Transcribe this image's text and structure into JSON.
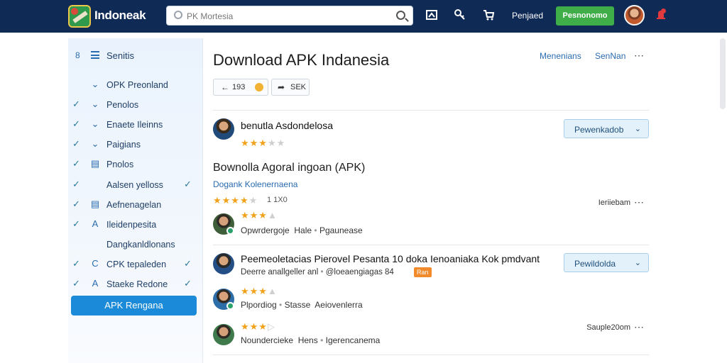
{
  "header": {
    "brand": "Indoneak",
    "search_placeholder": "PK Mortesia",
    "link": "Penjaed",
    "cta": "Pesnonomo"
  },
  "sidebar": {
    "heading_num": "8",
    "heading": "Senitis",
    "items": [
      {
        "label": "OPK Preonland",
        "icon": "chevron-down",
        "left_check": false,
        "right_check": false
      },
      {
        "label": "Penolos",
        "icon": "chevron-down",
        "left_check": true,
        "right_check": false
      },
      {
        "label": "Enaete Ileinns",
        "icon": "chevron-down",
        "left_check": true,
        "right_check": false
      },
      {
        "label": "Paigians",
        "icon": "chevron-down",
        "left_check": true,
        "right_check": false
      },
      {
        "label": "Pnolos",
        "icon": "doc",
        "left_check": true,
        "right_check": false
      },
      {
        "label": "Aalsen yelloss",
        "icon": "",
        "left_check": true,
        "right_check": true
      },
      {
        "label": "Aefnenagelan",
        "icon": "doc",
        "left_check": true,
        "right_check": false
      },
      {
        "label": "Ileidenpesita",
        "icon": "letter",
        "left_check": true,
        "right_check": false
      },
      {
        "label": "Dangkanldlonans",
        "icon": "",
        "left_check": false,
        "right_check": false
      },
      {
        "label": "CPK tepaleden",
        "icon": "circle",
        "left_check": true,
        "right_check": true
      },
      {
        "label": "Staeke Redone",
        "icon": "letter",
        "left_check": true,
        "right_check": true
      }
    ],
    "active": "APK Rengana"
  },
  "main": {
    "title": "Download APK Indanesia",
    "links": [
      "Menenians",
      "SenNan"
    ],
    "pill_count": "193",
    "pill_share": "SEK",
    "apps": [
      {
        "name": "benutla Asdondelosa",
        "rating": 2.5,
        "download_label": "Pewenkadob"
      },
      {
        "name": "Peemeoletacias Pierovel Pesanta 10 doka Ienoaniaka Kok pmdvant",
        "meta1": "Deerre anallgeller anl",
        "meta2": "@loeaengiagas 84",
        "tag": "Ran",
        "download_label": "Pewildolda"
      }
    ],
    "section": {
      "title": "Bownolla Agoral ingoan (APK)",
      "subtitle": "Dogank Kolenernaena",
      "rating_value": "1 1X0"
    },
    "reviews": [
      {
        "stars": 3,
        "author": "Opwrdergoje",
        "place": "Hale",
        "text": "Pgaunease",
        "time": "Ieriiebam"
      },
      {
        "stars": 3,
        "author": "Plpordiog",
        "place": "Stasse",
        "text": "Aeiovenlerra",
        "time": ""
      },
      {
        "stars": 3,
        "author": "Noundercieke",
        "place": "Hens",
        "text": "Igerencanema",
        "time": "Sauple20om"
      }
    ]
  },
  "colors": {
    "topbar": "#0f2a55",
    "cta": "#3fae49",
    "accent": "#1a8ad9",
    "star": "#f0a21a"
  },
  "icons": [
    "logo",
    "search-icon",
    "image-icon",
    "key-icon",
    "cart-icon",
    "bell-icon",
    "grid-icon",
    "check-icon",
    "chevron-down-icon",
    "more-icon",
    "share-icon",
    "star-icon"
  ]
}
